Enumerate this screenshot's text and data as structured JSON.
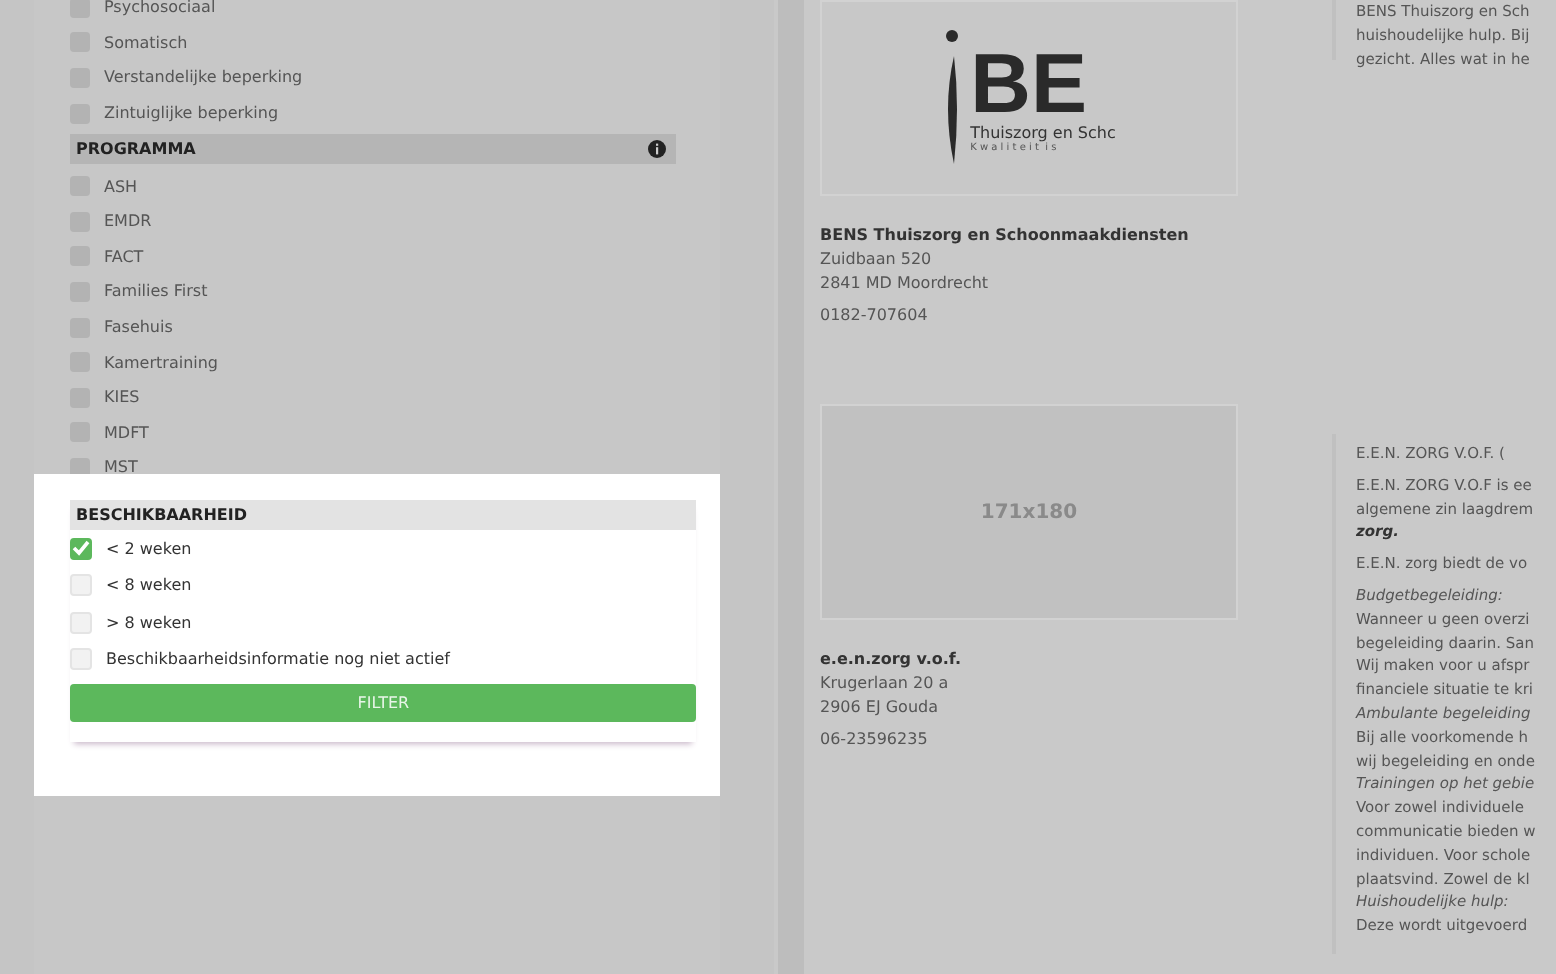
{
  "filters": {
    "top_items": [
      {
        "label": "Psychosociaal",
        "checked": false
      },
      {
        "label": "Somatisch",
        "checked": false
      },
      {
        "label": "Verstandelijke beperking",
        "checked": false
      },
      {
        "label": "Zintuiglijke beperking",
        "checked": false
      }
    ],
    "programma": {
      "title": "PROGRAMMA",
      "items": [
        {
          "label": "ASH",
          "checked": false
        },
        {
          "label": "EMDR",
          "checked": false
        },
        {
          "label": "FACT",
          "checked": false
        },
        {
          "label": "Families First",
          "checked": false
        },
        {
          "label": "Fasehuis",
          "checked": false
        },
        {
          "label": "Kamertraining",
          "checked": false
        },
        {
          "label": "KIES",
          "checked": false
        },
        {
          "label": "MDFT",
          "checked": false
        },
        {
          "label": "MST",
          "checked": false
        }
      ]
    },
    "beschikbaarheid": {
      "title": "BESCHIKBAARHEID",
      "items": [
        {
          "label": "< 2 weken",
          "checked": true
        },
        {
          "label": "< 8 weken",
          "checked": false
        },
        {
          "label": "> 8 weken",
          "checked": false
        },
        {
          "label": "Beschikbaarheidsinformatie nog niet actief",
          "checked": false
        }
      ],
      "button": "FILTER"
    }
  },
  "results": [
    {
      "image": {
        "kind": "logo",
        "big": "BE",
        "line": "Thuiszorg en Schc",
        "tagline": "K w a l i t e i t  i s"
      },
      "name": "BENS Thuiszorg en Schoonmaakdiensten",
      "street": "Zuidbaan 520",
      "city": "2841 MD Moordrecht",
      "phone": "0182-707604",
      "description": [
        {
          "lines": [
            {
              "text": "BENS Thuiszorg en Sch",
              "kind": "plain"
            },
            {
              "text": "huishoudelijke hulp. Bij",
              "kind": "plain"
            },
            {
              "text": "gezicht. Alles wat in he",
              "kind": "plain"
            }
          ]
        }
      ]
    },
    {
      "image": {
        "kind": "placeholder",
        "text": "171x180"
      },
      "name": "e.e.n.zorg v.o.f.",
      "street": "Krugerlaan 20 a",
      "city": "2906 EJ Gouda",
      "phone": "06-23596235",
      "description": [
        {
          "lines": [
            {
              "text": "E.E.N. ZORG V.O.F.   (",
              "kind": "plain"
            }
          ]
        },
        {
          "lines": [
            {
              "text": "E.E.N. ZORG V.O.F is ee",
              "kind": "plain"
            },
            {
              "text": "algemene zin laagdrem",
              "kind": "plain"
            },
            {
              "text": "zorg.",
              "kind": "emphasis"
            }
          ]
        },
        {
          "lines": [
            {
              "text": "E.E.N. zorg biedt de vo",
              "kind": "plain"
            }
          ]
        },
        {
          "lines": [
            {
              "text": "Budgetbegeleiding:",
              "kind": "heading"
            },
            {
              "text": "Wanneer u geen overzi",
              "kind": "plain"
            },
            {
              "text": "begeleiding daarin. San",
              "kind": "plain"
            },
            {
              "text": "Wij maken voor u afspr",
              "kind": "plain"
            },
            {
              "text": "financiele situatie te kri",
              "kind": "plain"
            },
            {
              "text": "Ambulante begeleiding",
              "kind": "heading"
            },
            {
              "text": "Bij alle voorkomende h",
              "kind": "plain"
            },
            {
              "text": "wij begeleiding en onde",
              "kind": "plain"
            },
            {
              "text": "Trainingen op het gebie",
              "kind": "heading"
            },
            {
              "text": "Voor zowel individuele",
              "kind": "plain"
            },
            {
              "text": "communicatie bieden w",
              "kind": "plain"
            },
            {
              "text": "individuen. Voor schole",
              "kind": "plain"
            },
            {
              "text": "plaatsvind. Zowel de kl",
              "kind": "plain"
            },
            {
              "text": "Huishoudelijke hulp:",
              "kind": "heading"
            },
            {
              "text": "Deze wordt uitgevoerd",
              "kind": "plain"
            }
          ]
        }
      ]
    }
  ]
}
